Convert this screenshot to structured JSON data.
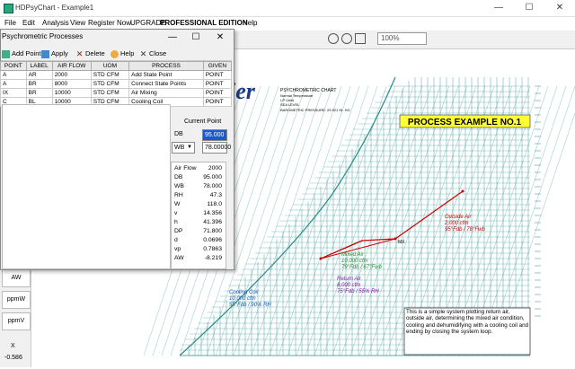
{
  "window": {
    "title": "HDPsyChart - Example1",
    "minimize": "—",
    "maximize": "☐",
    "close": "✕"
  },
  "menu": [
    "File",
    "Edit",
    "Analysis",
    "View",
    "Register Now",
    "UPGRADE",
    "PROFESSIONAL EDITION",
    "Help"
  ],
  "toolbar": {
    "zoom": "100%"
  },
  "dialog": {
    "title": "Psychrometric Processes",
    "buttons": [
      "Add Point",
      "Apply",
      "Delete",
      "Help",
      "Close"
    ],
    "columns": [
      "POINT",
      "LABEL",
      "AIR FLOW",
      "UOM",
      "PROCESS",
      "GIVEN"
    ],
    "rows": [
      [
        "A",
        "AR",
        "2000",
        "STD CFM",
        "Add State Point",
        "POINT"
      ],
      [
        "A",
        "BR",
        "8000",
        "STD CFM",
        "Connect State Points",
        "POINT"
      ],
      [
        "IX",
        "BR",
        "10000",
        "STD CFM",
        "Air Mixing",
        "POINT"
      ],
      [
        "C",
        "BL",
        "10000",
        "STD CFM",
        "Cooling Coil",
        "POINT"
      ]
    ],
    "current_point": {
      "title": "Current Point",
      "db_label": "DB",
      "db_value": "95.000",
      "wb_select": "WB",
      "wb_value": "78.00000"
    },
    "results": [
      [
        "Air Flow",
        "2000"
      ],
      [
        "DB",
        "95.000"
      ],
      [
        "WB",
        "78.000"
      ],
      [
        "RH",
        "47.3"
      ],
      [
        "W",
        "118.0"
      ],
      [
        "v",
        "14.356"
      ],
      [
        "h",
        "41.396"
      ],
      [
        "DP",
        "71.800"
      ],
      [
        "d",
        "0.0696"
      ],
      [
        "vp",
        "0.7863"
      ],
      [
        "AW",
        "-8.219"
      ]
    ]
  },
  "side_labels": [
    "AW",
    "ppmW",
    "ppmV"
  ],
  "side_x": {
    "label": "X",
    "value": "-0.586"
  },
  "chart": {
    "header_title": "PSYCHROMETRIC CHART",
    "header_lines": [
      "Normal Temperature",
      "I-P Units",
      "SEA LEVEL",
      "BAROMETRIC PRESSURE: 29.921 IN. HG"
    ],
    "logo": "ier",
    "example_title": "PROCESS EXAMPLE NO.1",
    "labels": {
      "outside": [
        "Outside Air",
        "2,000 cfm",
        "95°Fdb / 78°Fwb"
      ],
      "mixed": [
        "Mixed Air",
        "10,000 cfm",
        "79°Fdb / 67°Fwb"
      ],
      "return": [
        "Return Air",
        "8,000 cfm",
        "75°Fdb / 55% RH"
      ],
      "coil": [
        "Cooling Coil",
        "10,000 cfm",
        "55°Fdb / 90% RH"
      ],
      "mx": "MX"
    },
    "note": "This is a simple system plotting return air, outside air, determining the mixed air condition, cooling and dehumidifying with a cooling coil and ending by closing the system loop.",
    "colors": {
      "grid": "#2a8a8a",
      "process": "#cc0000",
      "outside": "#cc0000",
      "mixed": "#2a8a2a",
      "return": "#7a1aa0",
      "coil": "#1a5ab0"
    }
  }
}
